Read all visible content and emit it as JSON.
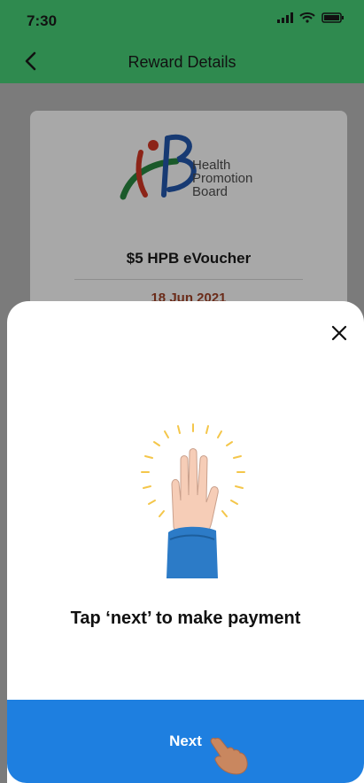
{
  "status_bar": {
    "time": "7:30"
  },
  "header": {
    "title": "Reward Details"
  },
  "reward": {
    "logo_text_line1": "Health",
    "logo_text_line2": "Promotion",
    "logo_text_line3": "Board",
    "name": "$5 HPB eVoucher",
    "date": "18 Jun 2021"
  },
  "sheet": {
    "message": "Tap ‘next’ to make payment",
    "next_label": "Next"
  },
  "colors": {
    "header_green": "#2f8a4f",
    "button_blue": "#1e7fe0",
    "hand": "#f6cdb7",
    "sleeve": "#2c7bc7",
    "rays": "#f4c64a"
  },
  "icons": [
    "back-arrow-icon",
    "signal-icon",
    "wifi-icon",
    "battery-icon",
    "close-icon",
    "hand-illustration",
    "pointing-hand-icon"
  ]
}
